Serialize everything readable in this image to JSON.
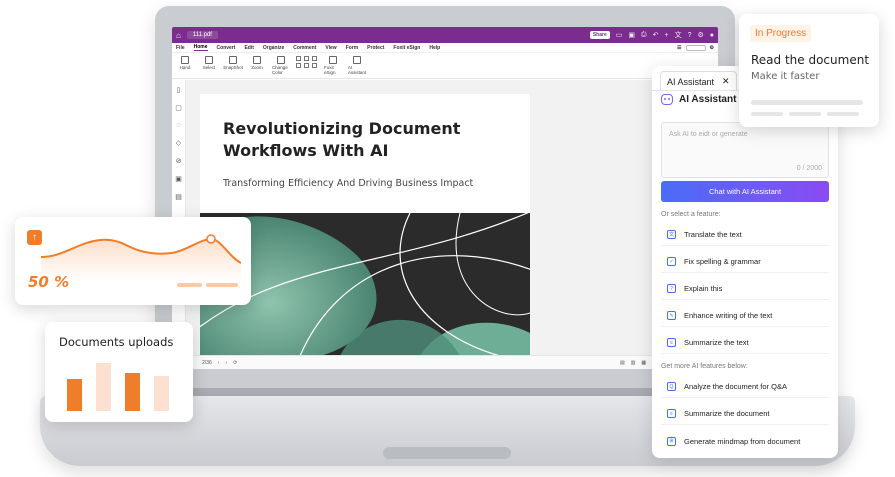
{
  "app": {
    "file_name": "111.pdf",
    "share_label": "Share",
    "menu": [
      "File",
      "Home",
      "Convert",
      "Edit",
      "Organize",
      "Comment",
      "View",
      "Form",
      "Protect",
      "Foxit eSign",
      "Help"
    ],
    "active_menu": "Home",
    "ribbon": [
      {
        "label": "Hand",
        "icon": "hand-icon"
      },
      {
        "label": "Select",
        "icon": "select-icon"
      },
      {
        "label": "SnapShot",
        "icon": "snapshot-icon"
      },
      {
        "label": "Zoom",
        "icon": "zoom-icon"
      },
      {
        "label": "Change Color",
        "icon": "change-color-icon"
      },
      {
        "label": "Foxit eSign",
        "icon": "esign-icon"
      },
      {
        "label": "AI Assistant",
        "icon": "ai-assistant-icon"
      }
    ],
    "page_indicator": "2/36"
  },
  "document": {
    "title": "Revolutionizing Document Workflows With AI",
    "subtitle": "Transforming Efficiency And Driving Business Impact"
  },
  "ai_panel": {
    "tab_label": "AI Assistant",
    "header": "AI Assistant",
    "input_placeholder": "Ask AI to eidt or generate",
    "char_count": "0 / 2000",
    "chat_button": "Chat with AI Assistant",
    "features_heading": "Or select a feature:",
    "features": [
      {
        "label": "Translate the text",
        "icon": "translate-icon"
      },
      {
        "label": "Fix spelling & grammar",
        "icon": "spellcheck-icon"
      },
      {
        "label": "Explain this",
        "icon": "explain-icon"
      },
      {
        "label": "Enhance writing of the text",
        "icon": "enhance-icon"
      },
      {
        "label": "Summarize the text",
        "icon": "summarize-icon"
      }
    ],
    "more_heading": "Get more AI features below:",
    "more_features": [
      {
        "label": "Analyze the document for Q&A",
        "icon": "analyze-icon"
      },
      {
        "label": "Summarize the document",
        "icon": "summarize-doc-icon"
      },
      {
        "label": "Generate mindmap from document",
        "icon": "mindmap-icon"
      }
    ]
  },
  "progress_card": {
    "badge": "In Progress",
    "title": "Read the document",
    "subtitle": "Make it faster"
  },
  "stat_card": {
    "value": "50 %"
  },
  "uploads_card": {
    "title": "Documents uploads",
    "bars": [
      {
        "value": 0.55,
        "color": "#f07d2a"
      },
      {
        "value": 0.82,
        "color": "#fde0d0"
      },
      {
        "value": 0.65,
        "color": "#f07d2a"
      },
      {
        "value": 0.6,
        "color": "#fde0d0"
      }
    ]
  },
  "colors": {
    "accent": "#f07d2a",
    "brand": "#7b2c8e",
    "ai_gradient_start": "#4a6cf7",
    "ai_gradient_end": "#8a4cf2"
  }
}
